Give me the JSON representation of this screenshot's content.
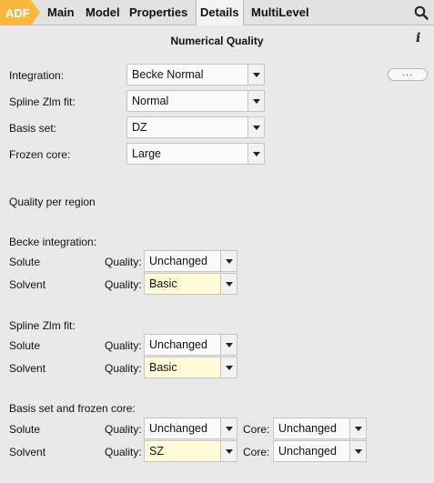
{
  "tabs": {
    "adf": "ADF",
    "main": "Main",
    "model": "Model",
    "properties": "Properties",
    "details": "Details",
    "multilevel": "MultiLevel"
  },
  "panel": {
    "title": "Numerical Quality",
    "more_button": "..."
  },
  "fields": {
    "integration": {
      "label": "Integration:",
      "value": "Becke Normal"
    },
    "spline": {
      "label": "Spline Zlm fit:",
      "value": "Normal"
    },
    "basis": {
      "label": "Basis set:",
      "value": "DZ"
    },
    "frozen": {
      "label": "Frozen core:",
      "value": "Large"
    }
  },
  "regions": {
    "heading": "Quality per region",
    "quality_label": "Quality:",
    "core_label": "Core:",
    "becke": {
      "heading": "Becke integration:",
      "solute": {
        "name": "Solute",
        "quality": "Unchanged"
      },
      "solvent": {
        "name": "Solvent",
        "quality": "Basic"
      }
    },
    "spline": {
      "heading": "Spline Zlm fit:",
      "solute": {
        "name": "Solute",
        "quality": "Unchanged"
      },
      "solvent": {
        "name": "Solvent",
        "quality": "Basic"
      }
    },
    "basis": {
      "heading": "Basis set and frozen core:",
      "solute": {
        "name": "Solute",
        "quality": "Unchanged",
        "core": "Unchanged"
      },
      "solvent": {
        "name": "Solvent",
        "quality": "SZ",
        "core": "Unchanged"
      }
    }
  },
  "colors": {
    "adf_tab": "#f6b93e",
    "highlight_field": "#fffbd8",
    "background": "#e9e9e9"
  },
  "icons": {
    "search": "search-icon",
    "info": "info-icon"
  }
}
